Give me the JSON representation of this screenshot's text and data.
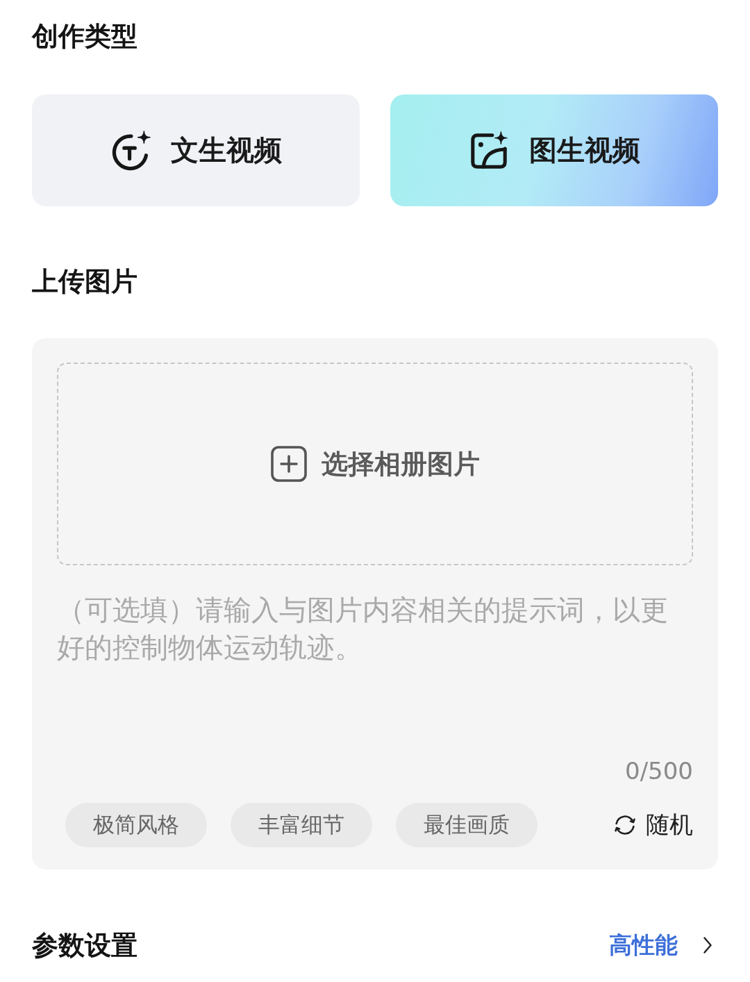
{
  "creation_type": {
    "title": "创作类型",
    "options": [
      {
        "kind": "text",
        "label": "文生视频",
        "selected": false
      },
      {
        "kind": "image",
        "label": "图生视频",
        "selected": true
      }
    ]
  },
  "upload": {
    "title": "上传图片",
    "picker": {
      "label": "选择相册图片"
    },
    "prompt": {
      "placeholder": "（可选填）请输入与图片内容相关的提示词，以更好的控制物体运动轨迹。",
      "counter": "0/500"
    },
    "tags": [
      "极简风格",
      "丰富细节",
      "最佳画质"
    ],
    "random_button": {
      "label": "随机"
    }
  },
  "parameters": {
    "title": "参数设置",
    "value": "高性能"
  }
}
